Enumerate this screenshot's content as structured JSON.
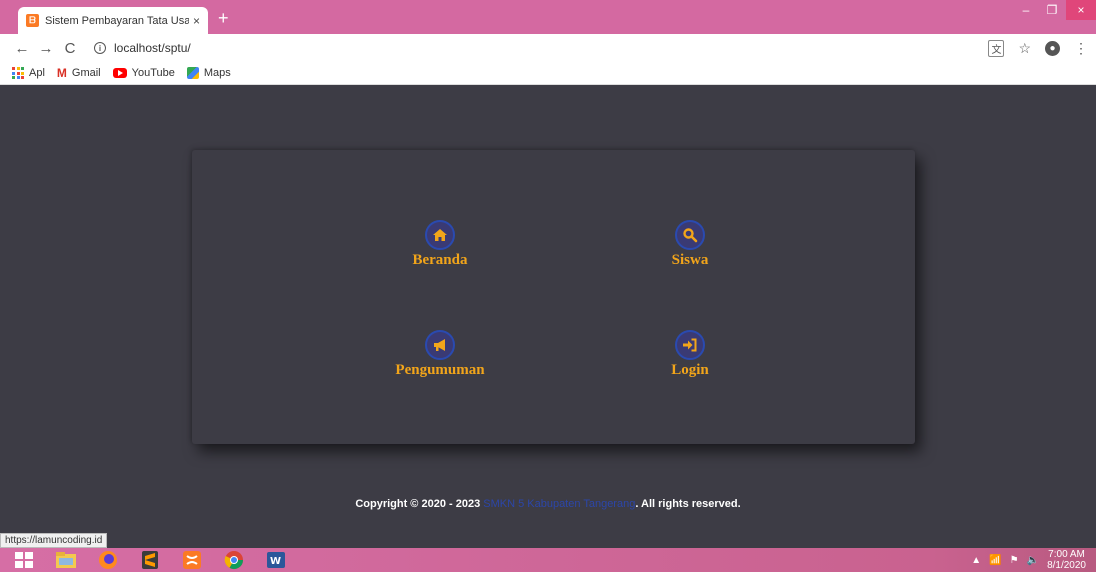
{
  "browser": {
    "tab_title": "Sistem Pembayaran Tata Usaha",
    "tab_close": "×",
    "new_tab": "+",
    "url": "localhost/sptu/",
    "bookmarks": [
      {
        "label": "Apl",
        "icon": "apps-grid-icon"
      },
      {
        "label": "Gmail",
        "icon": "gmail-icon"
      },
      {
        "label": "YouTube",
        "icon": "youtube-icon"
      },
      {
        "label": "Maps",
        "icon": "maps-icon"
      }
    ],
    "window_controls": {
      "minimize": "–",
      "maximize": "❐",
      "close": "×"
    }
  },
  "menu": [
    {
      "label": "Beranda",
      "icon": "home-icon"
    },
    {
      "label": "Siswa",
      "icon": "search-icon"
    },
    {
      "label": "Pengumuman",
      "icon": "bullhorn-icon"
    },
    {
      "label": "Login",
      "icon": "sign-in-icon"
    }
  ],
  "footer": {
    "prefix": "Copyright © 2020 - 2023 ",
    "link_text": "SMKN 5 Kabupaten Tangerang",
    "suffix": ". All rights reserved."
  },
  "status_bar_url": "https://lamuncoding.id",
  "taskbar": {
    "apps": [
      "windows-start-icon",
      "file-explorer-icon",
      "firefox-icon",
      "sublime-text-icon",
      "xampp-icon",
      "chrome-icon",
      "word-icon"
    ],
    "clock_time": "7:00 AM",
    "clock_date": "8/1/2020"
  },
  "colors": {
    "page_bg": "#3d3c45",
    "accent_label": "#f2a51a",
    "icon_circle": "#3a3a74",
    "icon_ring": "#2a4ab0",
    "footer_link": "#2c46a8",
    "chrome_pink": "#d469a1"
  }
}
